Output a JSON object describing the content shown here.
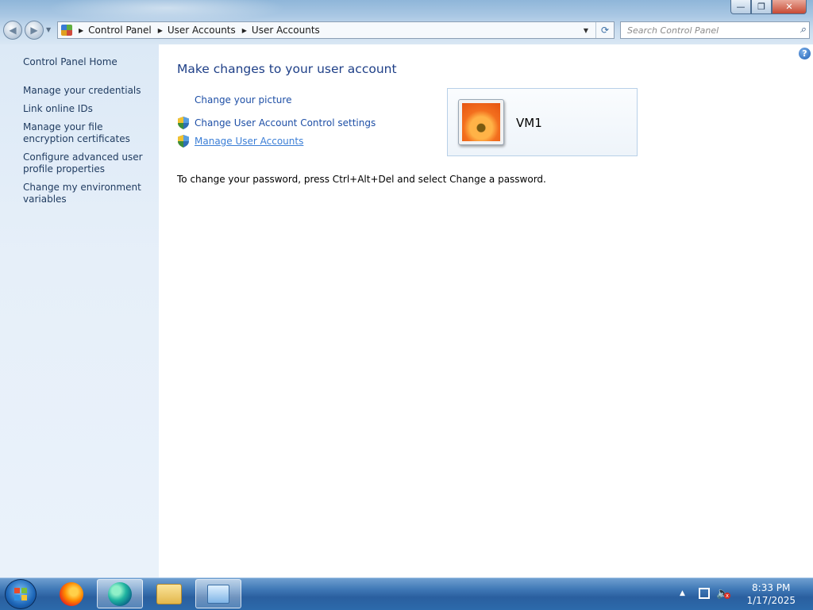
{
  "window": {
    "controls": {
      "minimize": "—",
      "restore": "❐",
      "close": "✕"
    }
  },
  "navigation": {
    "back_icon": "◀",
    "forward_icon": "▶",
    "dropdown_icon": "▼"
  },
  "address_bar": {
    "breadcrumbs": [
      "Control Panel",
      "User Accounts",
      "User Accounts"
    ],
    "dropdown_icon": "▼",
    "refresh_icon": "⟳"
  },
  "search": {
    "placeholder": "Search Control Panel",
    "icon": "magnifier-icon"
  },
  "sidebar": {
    "items": [
      {
        "label": "Control Panel Home"
      },
      {
        "label": "Manage your credentials"
      },
      {
        "label": "Link online IDs"
      },
      {
        "label": "Manage your file encryption certificates"
      },
      {
        "label": "Configure advanced user profile properties"
      },
      {
        "label": "Change my environment variables"
      }
    ]
  },
  "main": {
    "title": "Make changes to your user account",
    "tasks": [
      {
        "label": "Change your picture",
        "shield": false
      },
      {
        "label": "Change User Account Control settings",
        "shield": true
      },
      {
        "label": "Manage User Accounts",
        "shield": true,
        "hovered": true
      }
    ],
    "info": "To change your password, press Ctrl+Alt+Del and select Change a password.",
    "help_icon": "?"
  },
  "user_card": {
    "name": "VM1"
  },
  "taskbar": {
    "apps": [
      "start-orb",
      "firefox",
      "edge",
      "file-explorer",
      "control-panel"
    ],
    "active_app": "edge",
    "tray": {
      "up_arrow": "▲",
      "volume": "🔈",
      "mute_badge": "x"
    },
    "clock": {
      "time": "8:33 PM",
      "date": "1/17/2025"
    }
  },
  "colors": {
    "link": "#1e4fa6",
    "link_hover": "#3b7ed6",
    "title": "#1e3f87",
    "sidebar_bg": "#dce9f6"
  }
}
